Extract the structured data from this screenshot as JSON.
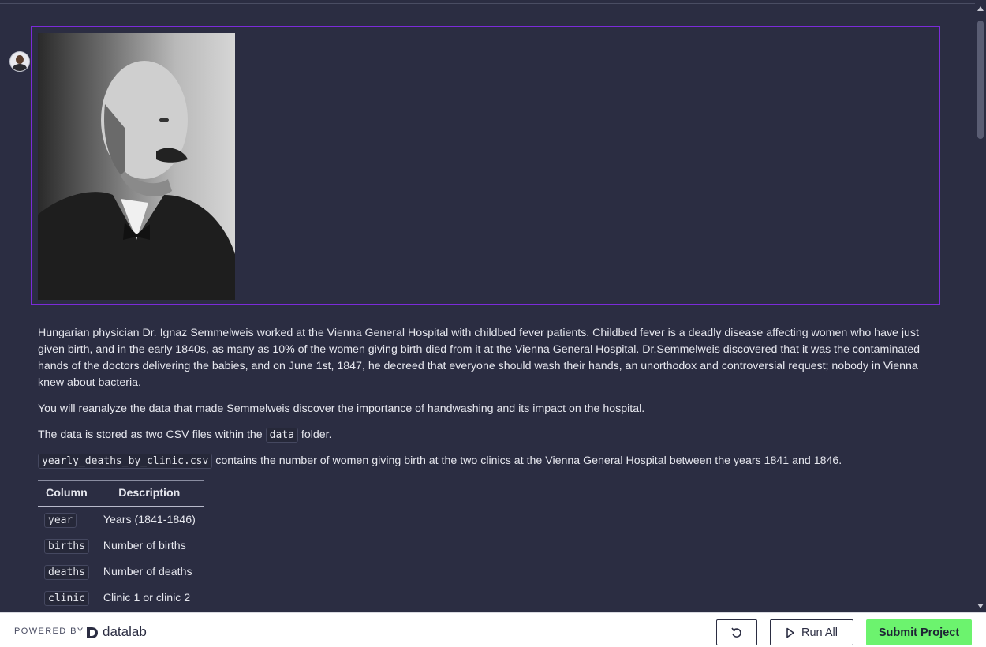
{
  "notebook": {
    "paragraphs": {
      "intro": "Hungarian physician Dr. Ignaz Semmelweis worked at the Vienna General Hospital with childbed fever patients. Childbed fever is a deadly disease affecting women who have just given birth, and in the early 1840s, as many as 10% of the women giving birth died from it at the Vienna General Hospital. Dr.Semmelweis discovered that it was the contaminated hands of the doctors delivering the babies, and on June 1st, 1847, he decreed that everyone should wash their hands, an unorthodox and controversial request; nobody in Vienna knew about bacteria.",
      "reanalyze": "You will reanalyze the data that made Semmelweis discover the importance of handwashing and its impact on the hospital.",
      "data_stored_before": "The data is stored as two CSV files within the",
      "data_folder_code": "data",
      "data_stored_after": "folder.",
      "csv_file_code": "yearly_deaths_by_clinic.csv",
      "csv_file_desc": "contains the number of women giving birth at the two clinics at the Vienna General Hospital between the years 1841 and 1846."
    },
    "table": {
      "headers": [
        "Column",
        "Description"
      ],
      "rows": [
        {
          "column": "year",
          "description": "Years (1841-1846)"
        },
        {
          "column": "births",
          "description": "Number of births"
        },
        {
          "column": "deaths",
          "description": "Number of deaths"
        },
        {
          "column": "clinic",
          "description": "Clinic 1 or clinic 2"
        }
      ]
    }
  },
  "footer": {
    "powered_by": "POWERED BY",
    "brand": "datalab",
    "run_all_label": "Run All",
    "submit_label": "Submit Project"
  },
  "colors": {
    "background": "#2b2d42",
    "selection_border": "#7b2bd9",
    "submit_green": "#6cf36e"
  }
}
